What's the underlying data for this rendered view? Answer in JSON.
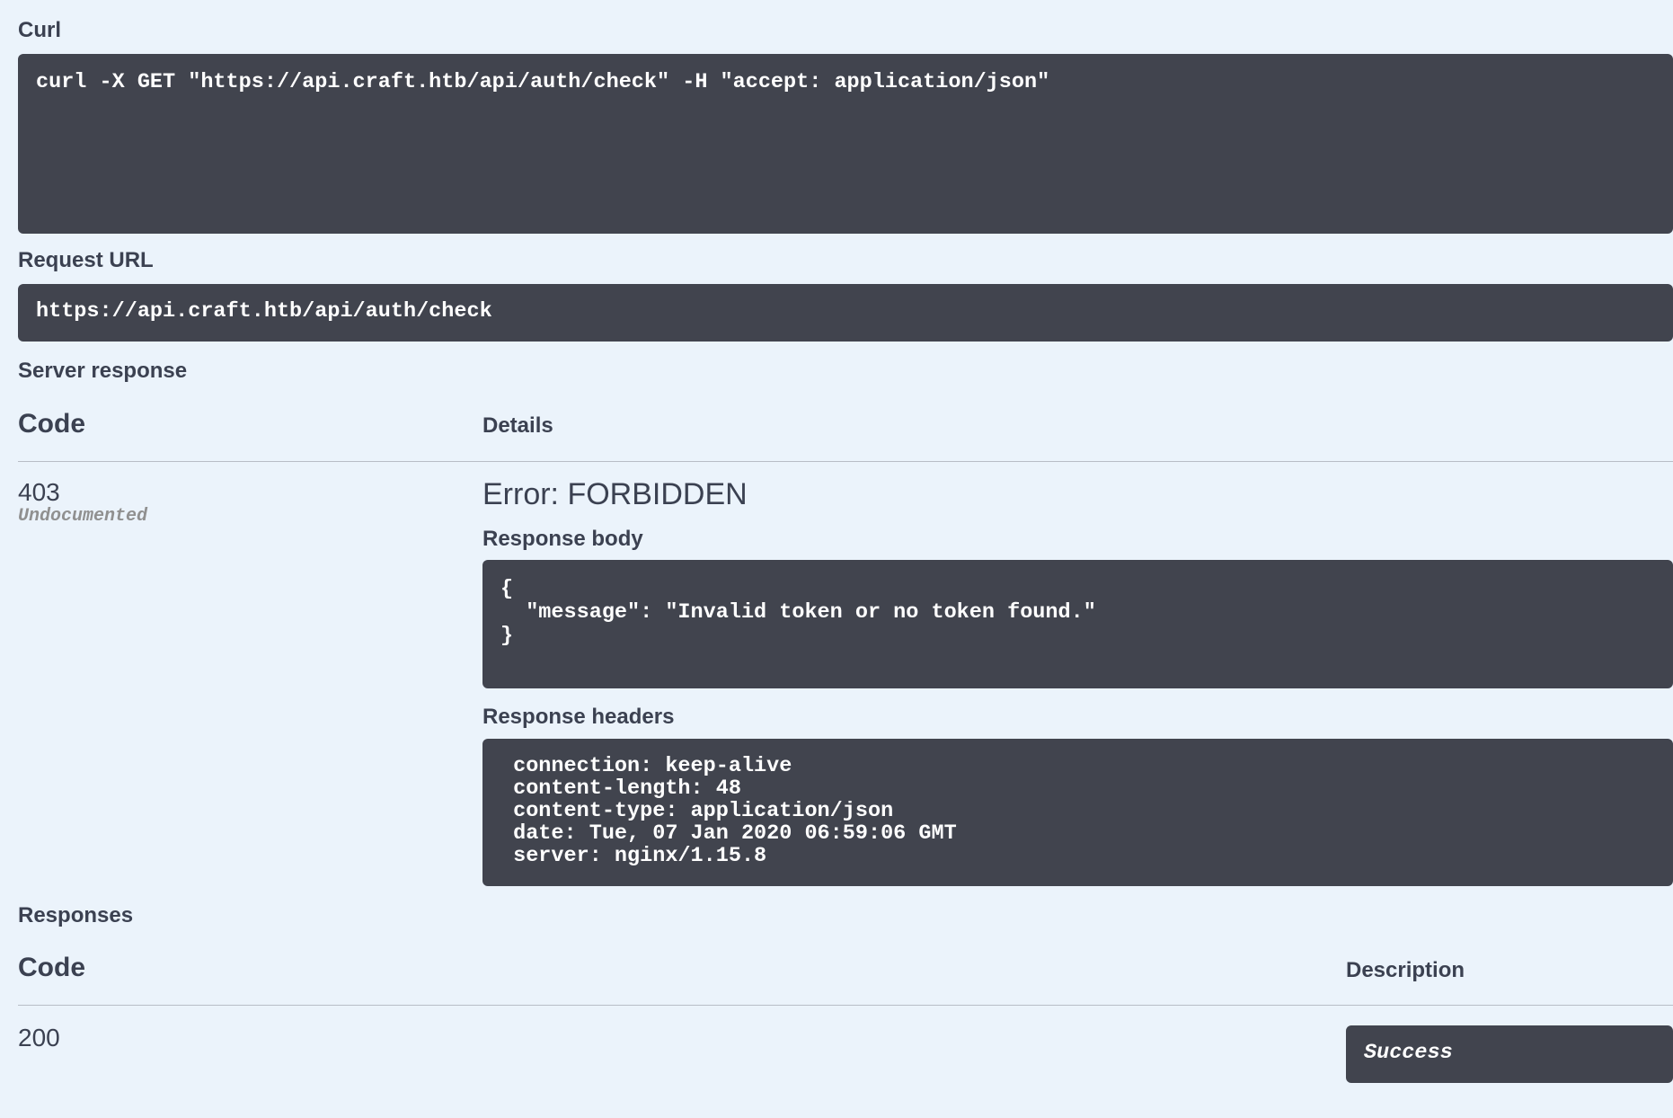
{
  "curl": {
    "label": "Curl",
    "command": "curl -X GET \"https://api.craft.htb/api/auth/check\" -H \"accept: application/json\""
  },
  "request_url": {
    "label": "Request URL",
    "value": "https://api.craft.htb/api/auth/check"
  },
  "server_response": {
    "label": "Server response",
    "code_header": "Code",
    "details_header": "Details",
    "code": "403",
    "code_note": "Undocumented",
    "error_title": "Error: FORBIDDEN",
    "body_label": "Response body",
    "body": "{\n  \"message\": \"Invalid token or no token found.\"\n}",
    "headers_label": "Response headers",
    "headers": " connection: keep-alive\n content-length: 48\n content-type: application/json\n date: Tue, 07 Jan 2020 06:59:06 GMT\n server: nginx/1.15.8"
  },
  "responses": {
    "label": "Responses",
    "code_header": "Code",
    "description_header": "Description",
    "rows": [
      {
        "code": "200",
        "description": "Success"
      }
    ]
  }
}
